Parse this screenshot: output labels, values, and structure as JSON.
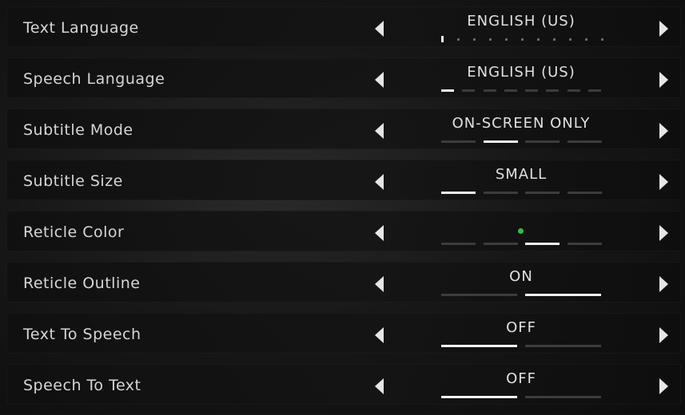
{
  "settings": [
    {
      "label": "Text Language",
      "value": "ENGLISH (US)",
      "track": "dots",
      "count": 11,
      "selected": 0
    },
    {
      "label": "Speech Language",
      "value": "ENGLISH (US)",
      "track": "segments",
      "count": 8,
      "selected": 0
    },
    {
      "label": "Subtitle Mode",
      "value": "ON-SCREEN ONLY",
      "track": "segments",
      "count": 4,
      "selected": 1
    },
    {
      "label": "Subtitle Size",
      "value": "SMALL",
      "track": "segments",
      "count": 4,
      "selected": 0
    },
    {
      "label": "Reticle Color",
      "value": "",
      "swatch_color": "#2fbf3f",
      "track": "segments",
      "count": 4,
      "selected": 2
    },
    {
      "label": "Reticle Outline",
      "value": "ON",
      "track": "segments",
      "count": 2,
      "selected": 1
    },
    {
      "label": "Text To Speech",
      "value": "OFF",
      "track": "segments",
      "count": 2,
      "selected": 0
    },
    {
      "label": "Speech To Text",
      "value": "OFF",
      "track": "segments",
      "count": 2,
      "selected": 0
    }
  ],
  "icons": {
    "previous": "triangle-left-icon",
    "next": "triangle-right-icon"
  }
}
